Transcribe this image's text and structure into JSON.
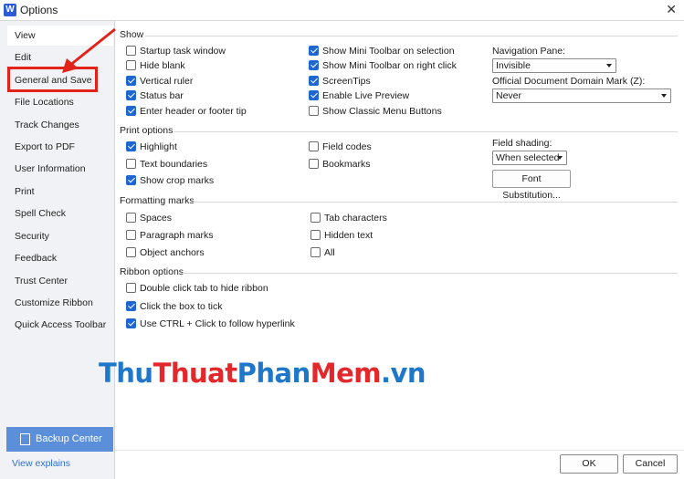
{
  "window": {
    "title": "Options",
    "app_icon": "W",
    "close_glyph": "✕"
  },
  "sidebar": {
    "items": [
      {
        "label": "View"
      },
      {
        "label": "Edit"
      },
      {
        "label": "General and Save"
      },
      {
        "label": "File Locations"
      },
      {
        "label": "Track Changes"
      },
      {
        "label": "Export to PDF"
      },
      {
        "label": "User Information"
      },
      {
        "label": "Print"
      },
      {
        "label": "Spell Check"
      },
      {
        "label": "Security"
      },
      {
        "label": "Feedback"
      },
      {
        "label": "Trust Center"
      },
      {
        "label": "Customize Ribbon"
      },
      {
        "label": "Quick Access Toolbar"
      }
    ],
    "active_index": 0,
    "backup_label": "Backup Center",
    "view_explains": "View explains"
  },
  "show": {
    "heading": "Show",
    "col1": [
      {
        "label": "Startup task window",
        "checked": false
      },
      {
        "label": "Hide blank",
        "checked": false
      },
      {
        "label": "Vertical ruler",
        "checked": true
      },
      {
        "label": "Status bar",
        "checked": true
      },
      {
        "label": "Enter header or footer tip",
        "checked": true
      }
    ],
    "col2": [
      {
        "label": "Show Mini Toolbar on selection",
        "checked": true
      },
      {
        "label": "Show Mini Toolbar on right click",
        "checked": true
      },
      {
        "label": "ScreenTips",
        "checked": true
      },
      {
        "label": "Enable Live Preview",
        "checked": true
      },
      {
        "label": "Show Classic Menu Buttons",
        "checked": false
      }
    ],
    "nav_pane_label": "Navigation Pane:",
    "nav_pane_value": "Invisible",
    "domain_mark_label": "Official Document Domain Mark (Z):",
    "domain_mark_value": "Never"
  },
  "print_options": {
    "heading": "Print options",
    "col1": [
      {
        "label": "Highlight",
        "checked": true
      },
      {
        "label": "Text boundaries",
        "checked": false
      },
      {
        "label": "Show crop marks",
        "checked": true
      }
    ],
    "col2": [
      {
        "label": "Field codes",
        "checked": false
      },
      {
        "label": "Bookmarks",
        "checked": false
      }
    ],
    "field_shading_label": "Field shading:",
    "field_shading_value": "When selected",
    "font_sub_label": "Font Substitution..."
  },
  "formatting_marks": {
    "heading": "Formatting marks",
    "col1": [
      {
        "label": "Spaces",
        "checked": false
      },
      {
        "label": "Paragraph marks",
        "checked": false
      },
      {
        "label": "Object anchors",
        "checked": false
      }
    ],
    "col2": [
      {
        "label": "Tab characters",
        "checked": false
      },
      {
        "label": "Hidden text",
        "checked": false
      },
      {
        "label": "All",
        "checked": false
      }
    ]
  },
  "ribbon_options": {
    "heading": "Ribbon options",
    "items": [
      {
        "label": "Double click tab to hide ribbon",
        "checked": false
      },
      {
        "label": "Click the box to tick",
        "checked": true
      },
      {
        "label": "Use CTRL + Click to follow hyperlink",
        "checked": true
      }
    ]
  },
  "watermark": {
    "p1": "Thu",
    "p2": "Thuat",
    "p3": "Phan",
    "p4": "Mem",
    "p5": ".vn"
  },
  "footer": {
    "ok_label": "OK",
    "cancel_label": "Cancel"
  },
  "colors": {
    "accent": "#1e66d2",
    "highlight_box": "#e2231a",
    "backup_bg": "#5b8fd9"
  }
}
